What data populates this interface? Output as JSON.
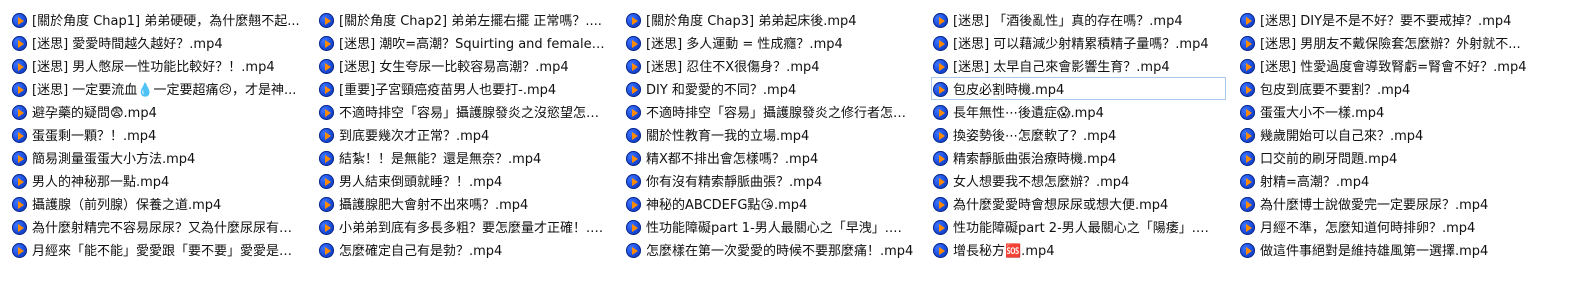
{
  "icon": "media-file-icon",
  "columns": [
    [
      "[關於角度 Chap1] 弟弟硬硬，為什麼翹不起...",
      "[迷思] 愛愛時間越久越好？.mp4",
      "[迷思] 男人憋尿一性功能比較好？！.mp4",
      "[迷思] 一定要流血💧一定要超痛😣，才是神...",
      "避孕藥的疑問😨.mp4",
      "蛋蛋剩一顆？！.mp4",
      "簡易測量蛋蛋大小方法.mp4",
      "男人的神秘那一點.mp4",
      "攝護腺（前列腺）保養之道.mp4",
      "為什麼射精完不容易尿尿？又為什麼尿尿有時...",
      "月經來「能不能」愛愛跟「要不要」愛愛是兩..."
    ],
    [
      "[關於角度 Chap2] 弟弟左擺右擺 正常嗎？....",
      "[迷思] 潮吹=高潮？Squirting and female ...",
      "[迷思] 女生夸尿一比較容易高潮？.mp4",
      "[重要]子宮頸癌疫苗男人也要打-.mp4",
      "不適時排空「容易」攝護腺發炎之沒慾望怎麼...",
      "到底要幾次才正常？.mp4",
      "結紮！！是無能？還是無奈？.mp4",
      "男人結束倒頭就睡？！.mp4",
      "攝護腺肥大會射不出來嗎？.mp4",
      "小弟弟到底有多長多粗？要怎麼量才正確！.m...",
      "怎麼確定自己有是勃？.mp4"
    ],
    [
      "[關於角度 Chap3] 弟弟起床後.mp4",
      "[迷思] 多人運動 = 性成癮？.mp4",
      "[迷思] 忍住不X很傷身？.mp4",
      "DIY 和愛愛的不同？.mp4",
      "不適時排空「容易」攝護腺發炎之修行者怎麼...",
      "關於性教育一我的立場.mp4",
      "精X都不排出會怎樣嗎？.mp4",
      "你有沒有精索靜脈曲張？.mp4",
      "神秘的ABCDEFG點😘.mp4",
      "性功能障礙part 1-男人最關心之「早洩」.mp4",
      "怎麼樣在第一次愛愛的時候不要那麼痛！.mp4"
    ],
    [
      "[迷思] 「酒後亂性」真的存在嗎？.mp4",
      "[迷思] 可以藉減少射精累積精子量嗎？.mp4",
      "[迷思] 太早自己來會影響生育？.mp4",
      "包皮必割時機.mp4",
      "長年無性⋯後遺症😱.mp4",
      "換姿勢後⋯怎麼軟了？.mp4",
      "精索靜脈曲張治療時機.mp4",
      "女人想要我不想怎麼辦？.mp4",
      "為什麼愛愛時會想尿尿或想大便.mp4",
      "性功能障礙part 2-男人最關心之「陽痿」.mp4",
      "增長秘方🆘.mp4"
    ],
    [
      "[迷思] DIY是不是不好？要不要戒掉？.mp4",
      "[迷思] 男朋友不戴保險套怎麼辦？外射就不...",
      "[迷思] 性愛過度會導致腎虧=腎會不好？.mp4",
      "包皮到底要不要割？.mp4",
      "蛋蛋大小不一樣.mp4",
      "幾歲開始可以自己來？.mp4",
      "口交前的刷牙問題.mp4",
      "射精=高潮？.mp4",
      "為什麼博士說做愛完一定要尿尿？.mp4",
      "月經不準，怎麼知道何時排卵？.mp4",
      "做這件事絕對是維持雄風第一選擇.mp4"
    ]
  ],
  "selected": {
    "column": 3,
    "row": 3
  }
}
